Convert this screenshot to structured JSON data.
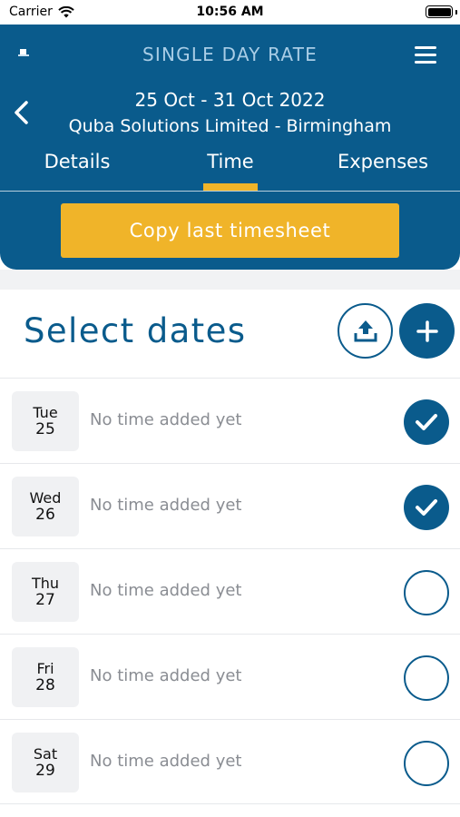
{
  "status_bar": {
    "carrier": "Carrier",
    "time": "10:56 AM"
  },
  "header": {
    "title": "SINGLE DAY RATE",
    "date_range": "25 Oct - 31 Oct 2022",
    "client": "Quba Solutions Limited - Birmingham",
    "icons": {
      "menu": "hamburger-menu-icon",
      "back": "chevron-left-icon",
      "logo": "app-logo"
    }
  },
  "tabs": [
    {
      "label": "Details",
      "active": false
    },
    {
      "label": "Time",
      "active": true
    },
    {
      "label": "Expenses",
      "active": false
    }
  ],
  "copy_button": {
    "label": "Copy last timesheet"
  },
  "section": {
    "title": "Select dates",
    "icons": {
      "upload": "upload-icon",
      "add": "plus-icon"
    }
  },
  "days": [
    {
      "day": "Tue",
      "date": "25",
      "status": "No time added yet",
      "selected": true
    },
    {
      "day": "Wed",
      "date": "26",
      "status": "No time added yet",
      "selected": true
    },
    {
      "day": "Thu",
      "date": "27",
      "status": "No time added yet",
      "selected": false
    },
    {
      "day": "Fri",
      "date": "28",
      "status": "No time added yet",
      "selected": false
    },
    {
      "day": "Sat",
      "date": "29",
      "status": "No time added yet",
      "selected": false
    }
  ],
  "colors": {
    "primary": "#0a5b8c",
    "accent": "#f0b429",
    "muted_text": "#8a8d93"
  }
}
